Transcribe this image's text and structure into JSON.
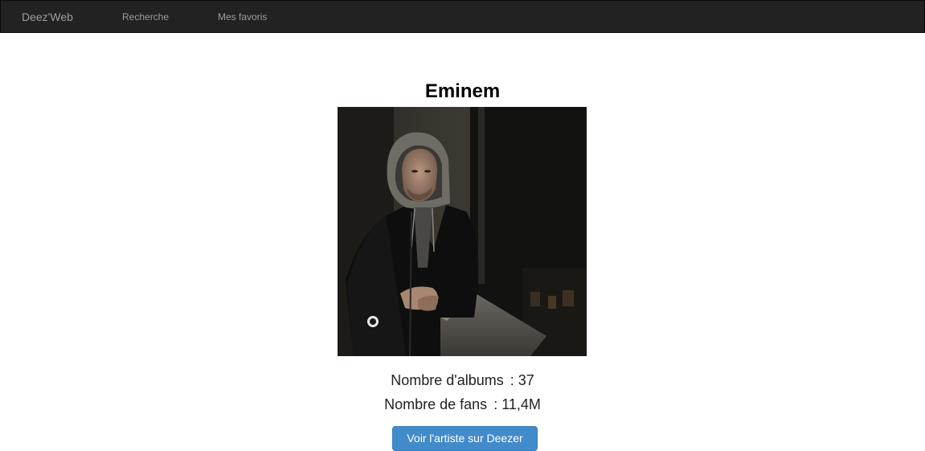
{
  "navbar": {
    "brand": "Deez'Web",
    "links": [
      {
        "label": "Recherche"
      },
      {
        "label": "Mes favoris"
      }
    ]
  },
  "artist": {
    "name": "Eminem",
    "photo_alt": "Eminem",
    "stats": [
      {
        "label": "Nombre d'albums",
        "value": ": 37"
      },
      {
        "label": "Nombre de fans",
        "value": ": 11,4M"
      }
    ],
    "cta_label": "Voir l'artiste sur Deezer"
  },
  "colors": {
    "navbar_bg": "#222222",
    "navbar_text": "#9d9d9d",
    "button_bg": "#428bca",
    "button_text": "#ffffff"
  }
}
